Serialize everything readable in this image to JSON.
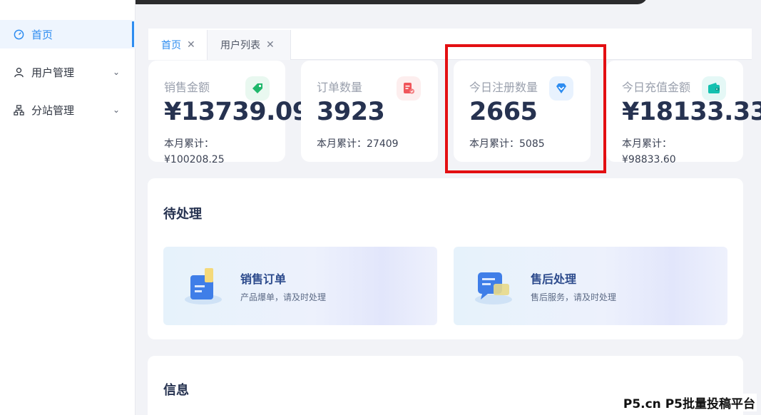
{
  "sidebar": {
    "items": [
      {
        "label": "首页",
        "icon": "dashboard-icon",
        "active": true
      },
      {
        "label": "用户管理",
        "icon": "user-icon",
        "expandable": true
      },
      {
        "label": "分站管理",
        "icon": "sitemap-icon",
        "expandable": true
      }
    ]
  },
  "tabs": [
    {
      "label": "首页",
      "active": true
    },
    {
      "label": "用户列表",
      "active": false
    }
  ],
  "stats": [
    {
      "label": "销售金额",
      "value": "¥13739.09",
      "sub_line1": "本月累计：",
      "sub_line2": "¥100208.25",
      "icon": "tag-icon",
      "accent": "#1fb86b"
    },
    {
      "label": "订单数量",
      "value": "3923",
      "sub_line1": "本月累计：27409",
      "sub_line2": "",
      "icon": "order-icon",
      "accent": "#f0555a"
    },
    {
      "label": "今日注册数量",
      "value": "2665",
      "sub_line1": "本月累计：5085",
      "sub_line2": "",
      "icon": "diamond-icon",
      "accent": "#2d8cf0"
    },
    {
      "label": "今日充值金额",
      "value": "¥18133.33",
      "sub_line1": "本月累计：",
      "sub_line2": "¥98833.60",
      "icon": "wallet-icon",
      "accent": "#14c1b0"
    }
  ],
  "pending": {
    "title": "待处理",
    "items": [
      {
        "title": "销售订单",
        "desc": "产品爆单，请及时处理",
        "icon": "sales-order-icon"
      },
      {
        "title": "售后处理",
        "desc": "售后服务，请及时处理",
        "icon": "after-sales-icon"
      }
    ]
  },
  "info": {
    "title": "信息"
  },
  "watermark": "P5.cn P5批量投稿平台",
  "colors": {
    "primary": "#2d8cf0",
    "highlight": "#e30f12",
    "background": "#f2f3f7"
  }
}
